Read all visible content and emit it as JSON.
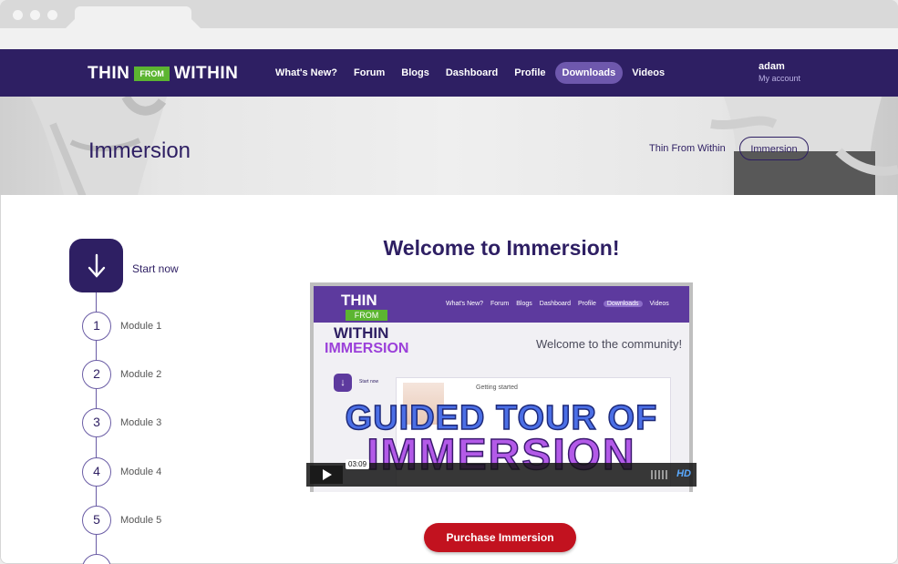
{
  "brand": {
    "logo_left": "THIN",
    "logo_mid": "FROM",
    "logo_right": "WITHIN"
  },
  "nav": {
    "items": [
      {
        "label": "What's New?"
      },
      {
        "label": "Forum"
      },
      {
        "label": "Blogs"
      },
      {
        "label": "Dashboard"
      },
      {
        "label": "Profile"
      },
      {
        "label": "Downloads"
      },
      {
        "label": "Videos"
      }
    ],
    "active_index": 5,
    "user": {
      "name": "adam",
      "account": "My account"
    }
  },
  "hero": {
    "title": "Immersion",
    "breadcrumb_parent": "Thin From Within",
    "breadcrumb_current": "Immersion"
  },
  "steps": {
    "start_label": "Start now",
    "modules": [
      {
        "num": "1",
        "label": "Module 1"
      },
      {
        "num": "2",
        "label": "Module 2"
      },
      {
        "num": "3",
        "label": "Module 3"
      },
      {
        "num": "4",
        "label": "Module 4"
      },
      {
        "num": "5",
        "label": "Module 5"
      }
    ]
  },
  "main": {
    "welcome": "Welcome to Immersion!",
    "video": {
      "thumb_logo_thin": "THIN",
      "thumb_logo_from": "FROM",
      "thumb_logo_within": "WITHIN",
      "thumb_logo_immersion": "IMMERSION",
      "thumb_nav": [
        "What's New?",
        "Forum",
        "Blogs",
        "Dashboard",
        "Profile",
        "Downloads",
        "Videos"
      ],
      "thumb_welcome": "Welcome to the community!",
      "thumb_start": "Start now",
      "thumb_getting_started": "Getting started",
      "overlay_line1": "GUIDED TOUR OF",
      "overlay_line2": "IMMERSION",
      "time": "03:09",
      "hd_label": "HD"
    },
    "purchase_label": "Purchase Immersion"
  },
  "colors": {
    "primary": "#2e1f63",
    "accent_green": "#5cb531",
    "purchase_red": "#c2121f",
    "active_pill": "#6e58ad"
  }
}
